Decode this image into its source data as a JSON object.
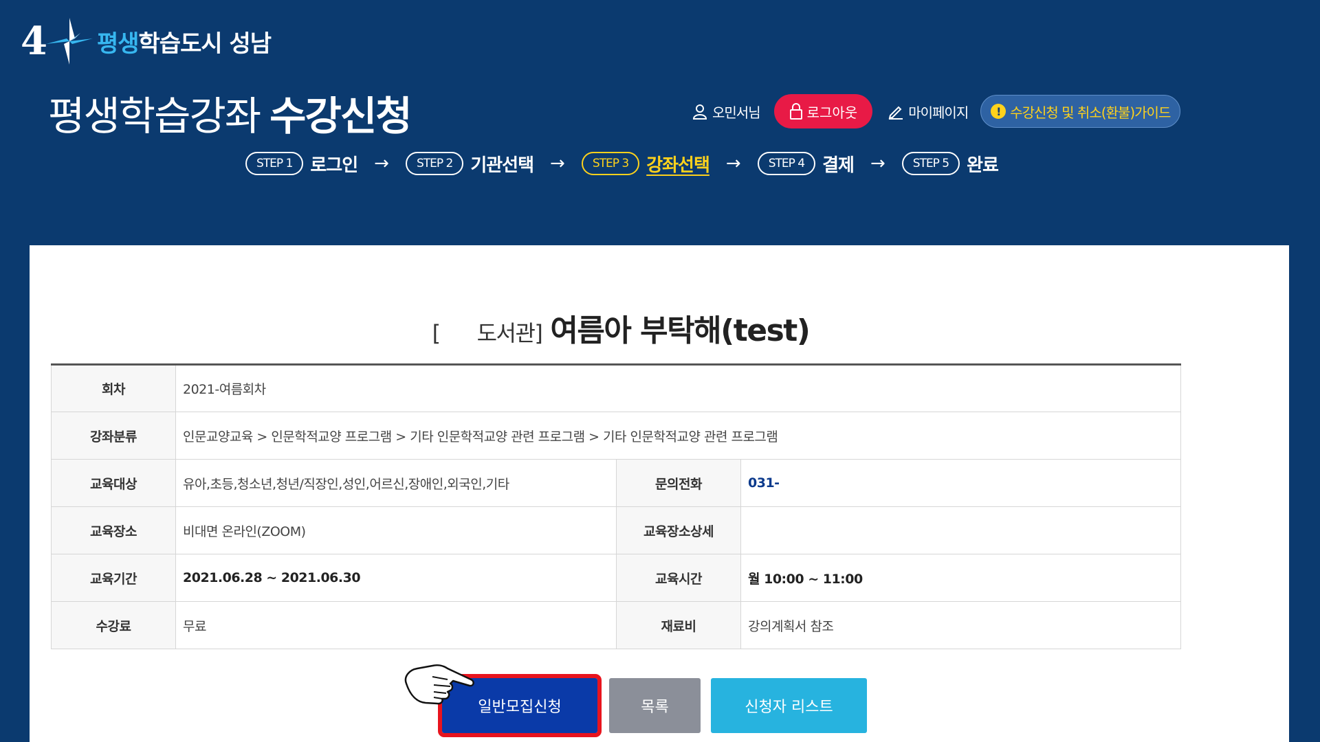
{
  "header": {
    "logo_number": "4",
    "logo_text_highlight": "평생",
    "logo_text_rest": "학습도시 성남",
    "page_title_light": "평생학습강좌",
    "page_title_bold": "수강신청",
    "user_name": "오민서님",
    "logout_label": "로그아웃",
    "mypage_label": "마이페이지",
    "guide_label": "수강신청 및 취소(환불)가이드"
  },
  "steps": [
    {
      "badge": "STEP 1",
      "label": "로그인"
    },
    {
      "badge": "STEP 2",
      "label": "기관선택"
    },
    {
      "badge": "STEP 3",
      "label": "강좌선택",
      "active": true
    },
    {
      "badge": "STEP 4",
      "label": "결제"
    },
    {
      "badge": "STEP 5",
      "label": "완료"
    }
  ],
  "arrow": "→",
  "course": {
    "org_open": "[",
    "org_name": "도서관]",
    "title": "여름아 부탁해(test)"
  },
  "info": {
    "session_label": "회차",
    "session_value": "2021-여름회차",
    "category_label": "강좌분류",
    "category_value": "인문교양교육 > 인문학적교양 프로그램 > 기타 인문학적교양 관련 프로그램 > 기타 인문학적교양 관련 프로그램",
    "target_label": "교육대상",
    "target_value": "유아,초등,청소년,청년/직장인,성인,어르신,장애인,외국인,기타",
    "phone_label": "문의전화",
    "phone_value": "031-",
    "place_label": "교육장소",
    "place_value": "비대면 온라인(ZOOM)",
    "place_detail_label": "교육장소상세",
    "place_detail_value": "",
    "period_label": "교육기간",
    "period_value": "2021.06.28 ~ 2021.06.30",
    "time_label": "교육시간",
    "time_value": "월 10:00 ~ 11:00",
    "fee_label": "수강료",
    "fee_value": "무료",
    "material_label": "재료비",
    "material_value": "강의계획서 참조"
  },
  "buttons": {
    "apply": "일반모집신청",
    "list": "목록",
    "applicants": "신청자 리스트"
  },
  "colors": {
    "header_bg": "#0b3a6f",
    "logout_bg": "#e81a46",
    "active_step": "#ffd21c",
    "apply_btn": "#0a3aa8",
    "apply_highlight": "#e8141e",
    "list_btn": "#8b8f99",
    "applicants_btn": "#27b3df"
  }
}
